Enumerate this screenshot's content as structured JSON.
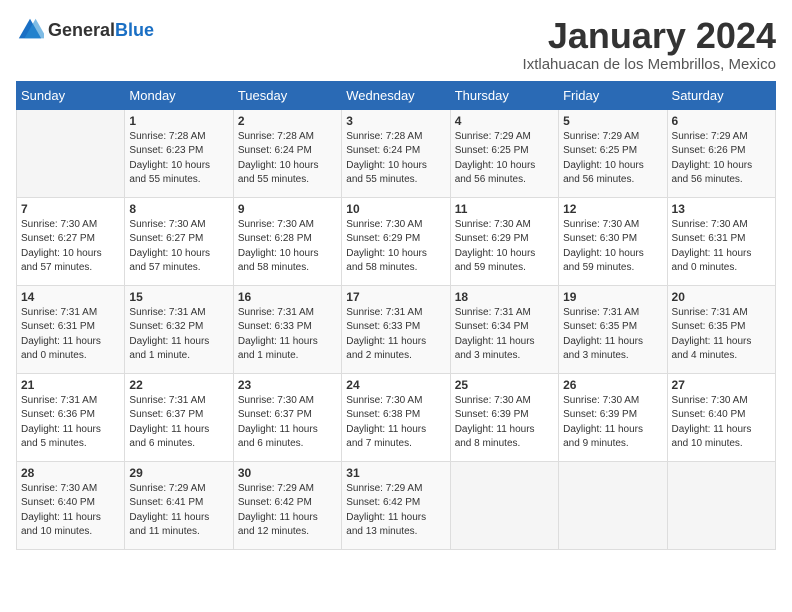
{
  "header": {
    "logo_general": "General",
    "logo_blue": "Blue",
    "month_year": "January 2024",
    "location": "Ixtlahuacan de los Membrillos, Mexico"
  },
  "weekdays": [
    "Sunday",
    "Monday",
    "Tuesday",
    "Wednesday",
    "Thursday",
    "Friday",
    "Saturday"
  ],
  "weeks": [
    [
      {
        "day": "",
        "info": ""
      },
      {
        "day": "1",
        "info": "Sunrise: 7:28 AM\nSunset: 6:23 PM\nDaylight: 10 hours\nand 55 minutes."
      },
      {
        "day": "2",
        "info": "Sunrise: 7:28 AM\nSunset: 6:24 PM\nDaylight: 10 hours\nand 55 minutes."
      },
      {
        "day": "3",
        "info": "Sunrise: 7:28 AM\nSunset: 6:24 PM\nDaylight: 10 hours\nand 55 minutes."
      },
      {
        "day": "4",
        "info": "Sunrise: 7:29 AM\nSunset: 6:25 PM\nDaylight: 10 hours\nand 56 minutes."
      },
      {
        "day": "5",
        "info": "Sunrise: 7:29 AM\nSunset: 6:25 PM\nDaylight: 10 hours\nand 56 minutes."
      },
      {
        "day": "6",
        "info": "Sunrise: 7:29 AM\nSunset: 6:26 PM\nDaylight: 10 hours\nand 56 minutes."
      }
    ],
    [
      {
        "day": "7",
        "info": "Sunrise: 7:30 AM\nSunset: 6:27 PM\nDaylight: 10 hours\nand 57 minutes."
      },
      {
        "day": "8",
        "info": "Sunrise: 7:30 AM\nSunset: 6:27 PM\nDaylight: 10 hours\nand 57 minutes."
      },
      {
        "day": "9",
        "info": "Sunrise: 7:30 AM\nSunset: 6:28 PM\nDaylight: 10 hours\nand 58 minutes."
      },
      {
        "day": "10",
        "info": "Sunrise: 7:30 AM\nSunset: 6:29 PM\nDaylight: 10 hours\nand 58 minutes."
      },
      {
        "day": "11",
        "info": "Sunrise: 7:30 AM\nSunset: 6:29 PM\nDaylight: 10 hours\nand 59 minutes."
      },
      {
        "day": "12",
        "info": "Sunrise: 7:30 AM\nSunset: 6:30 PM\nDaylight: 10 hours\nand 59 minutes."
      },
      {
        "day": "13",
        "info": "Sunrise: 7:30 AM\nSunset: 6:31 PM\nDaylight: 11 hours\nand 0 minutes."
      }
    ],
    [
      {
        "day": "14",
        "info": "Sunrise: 7:31 AM\nSunset: 6:31 PM\nDaylight: 11 hours\nand 0 minutes."
      },
      {
        "day": "15",
        "info": "Sunrise: 7:31 AM\nSunset: 6:32 PM\nDaylight: 11 hours\nand 1 minute."
      },
      {
        "day": "16",
        "info": "Sunrise: 7:31 AM\nSunset: 6:33 PM\nDaylight: 11 hours\nand 1 minute."
      },
      {
        "day": "17",
        "info": "Sunrise: 7:31 AM\nSunset: 6:33 PM\nDaylight: 11 hours\nand 2 minutes."
      },
      {
        "day": "18",
        "info": "Sunrise: 7:31 AM\nSunset: 6:34 PM\nDaylight: 11 hours\nand 3 minutes."
      },
      {
        "day": "19",
        "info": "Sunrise: 7:31 AM\nSunset: 6:35 PM\nDaylight: 11 hours\nand 3 minutes."
      },
      {
        "day": "20",
        "info": "Sunrise: 7:31 AM\nSunset: 6:35 PM\nDaylight: 11 hours\nand 4 minutes."
      }
    ],
    [
      {
        "day": "21",
        "info": "Sunrise: 7:31 AM\nSunset: 6:36 PM\nDaylight: 11 hours\nand 5 minutes."
      },
      {
        "day": "22",
        "info": "Sunrise: 7:31 AM\nSunset: 6:37 PM\nDaylight: 11 hours\nand 6 minutes."
      },
      {
        "day": "23",
        "info": "Sunrise: 7:30 AM\nSunset: 6:37 PM\nDaylight: 11 hours\nand 6 minutes."
      },
      {
        "day": "24",
        "info": "Sunrise: 7:30 AM\nSunset: 6:38 PM\nDaylight: 11 hours\nand 7 minutes."
      },
      {
        "day": "25",
        "info": "Sunrise: 7:30 AM\nSunset: 6:39 PM\nDaylight: 11 hours\nand 8 minutes."
      },
      {
        "day": "26",
        "info": "Sunrise: 7:30 AM\nSunset: 6:39 PM\nDaylight: 11 hours\nand 9 minutes."
      },
      {
        "day": "27",
        "info": "Sunrise: 7:30 AM\nSunset: 6:40 PM\nDaylight: 11 hours\nand 10 minutes."
      }
    ],
    [
      {
        "day": "28",
        "info": "Sunrise: 7:30 AM\nSunset: 6:40 PM\nDaylight: 11 hours\nand 10 minutes."
      },
      {
        "day": "29",
        "info": "Sunrise: 7:29 AM\nSunset: 6:41 PM\nDaylight: 11 hours\nand 11 minutes."
      },
      {
        "day": "30",
        "info": "Sunrise: 7:29 AM\nSunset: 6:42 PM\nDaylight: 11 hours\nand 12 minutes."
      },
      {
        "day": "31",
        "info": "Sunrise: 7:29 AM\nSunset: 6:42 PM\nDaylight: 11 hours\nand 13 minutes."
      },
      {
        "day": "",
        "info": ""
      },
      {
        "day": "",
        "info": ""
      },
      {
        "day": "",
        "info": ""
      }
    ]
  ]
}
